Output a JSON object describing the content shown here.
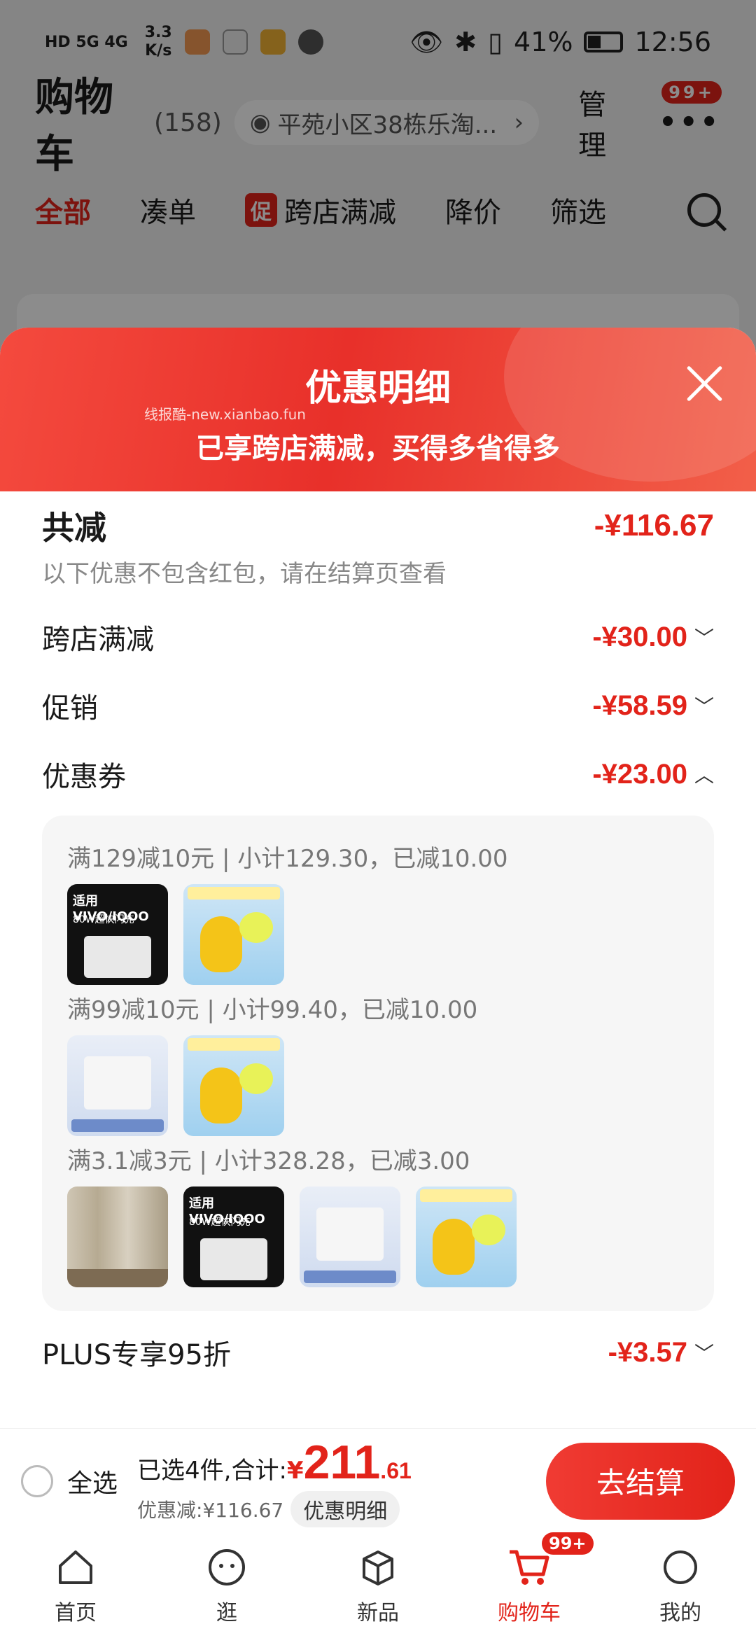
{
  "status_bar": {
    "network": "HD 5G 4G",
    "speed": "3.3",
    "speed_unit": "K/s",
    "battery": "41%",
    "time": "12:56"
  },
  "header": {
    "title": "购物车",
    "count": "(158)",
    "address": "平苑小区38栋乐淘...",
    "manage": "管理",
    "more_badge": "99+"
  },
  "tabs": [
    {
      "label": "全部"
    },
    {
      "label": "凑单"
    },
    {
      "label": "跨店满减",
      "tag": "促"
    },
    {
      "label": "降价"
    },
    {
      "label": "筛选"
    }
  ],
  "sheet": {
    "title": "优惠明细",
    "subtitle": "已享跨店满减，买得多省得多",
    "watermark": "线报酷-new.xianbao.fun",
    "total_label": "共减",
    "total_amount": "-¥116.67",
    "note": "以下优惠不包含红包，请在结算页查看",
    "items": [
      {
        "label": "跨店满减",
        "amount": "-¥30.00",
        "chevron": "﹀"
      },
      {
        "label": "促销",
        "amount": "-¥58.59",
        "chevron": "﹀"
      },
      {
        "label": "优惠券",
        "amount": "-¥23.00",
        "chevron": "︿"
      }
    ],
    "coupon_groups": [
      {
        "text": "满129减10元 | 小计129.30，已减10.00"
      },
      {
        "text": "满99减10元 | 小计99.40，已减10.00"
      },
      {
        "text": "满3.1减3元 | 小计328.28，已减3.00"
      }
    ],
    "charger_label": "适用VIVO/IQOO",
    "charger_sub": "80W超快闪充",
    "plus_label": "PLUS专享95折",
    "plus_amount": "-¥3.57",
    "plus_chevron": "﹀"
  },
  "checkout": {
    "select_all": "全选",
    "selected_text": "已选4件,合计:",
    "currency": "¥",
    "price_int": "211",
    "price_dec": ".61",
    "discount_text": "优惠减:¥116.67",
    "detail_button": "优惠明细",
    "checkout_button": "去结算"
  },
  "navbar": [
    {
      "label": "首页"
    },
    {
      "label": "逛"
    },
    {
      "label": "新品"
    },
    {
      "label": "购物车",
      "badge": "99+"
    },
    {
      "label": "我的"
    }
  ],
  "colors": {
    "accent": "#e2231a"
  }
}
